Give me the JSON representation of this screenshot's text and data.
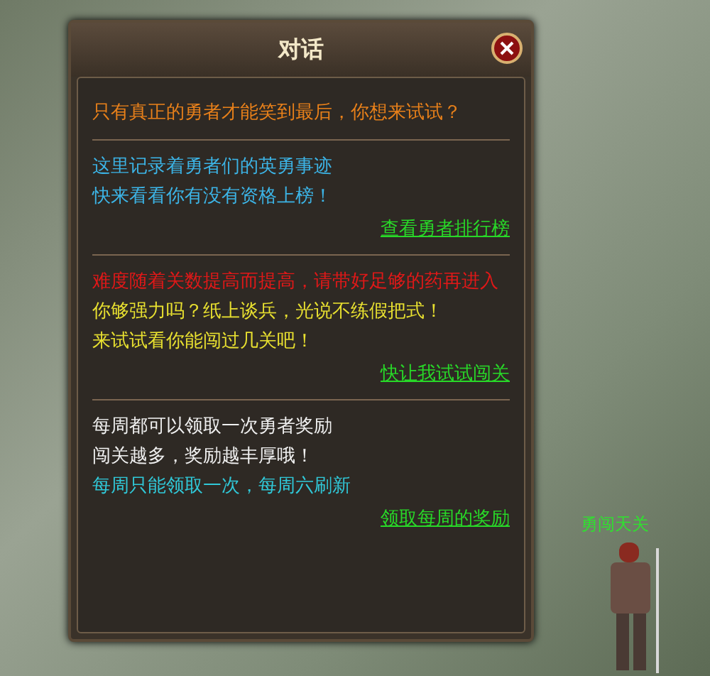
{
  "dialog": {
    "title": "对话",
    "sections": [
      {
        "lines": [
          {
            "text": "只有真正的勇者才能笑到最后，你想来试试？",
            "color": "#e8801a"
          }
        ]
      },
      {
        "lines": [
          {
            "text": "这里记录着勇者们的英勇事迹",
            "color": "#3cb4e6"
          },
          {
            "text": "快来看看你有没有资格上榜！",
            "color": "#3cb4e6"
          }
        ],
        "link": "查看勇者排行榜"
      },
      {
        "lines": [
          {
            "text": "难度随着关数提高而提高，请带好足够的药再进入",
            "color": "#e01818"
          },
          {
            "text": "你够强力吗？纸上谈兵，光说不练假把式！",
            "color": "#e8e030"
          },
          {
            "text": "来试试看你能闯过几关吧！",
            "color": "#e8e030"
          }
        ],
        "link": "快让我试试闯关"
      },
      {
        "lines": [
          {
            "text": "每周都可以领取一次勇者奖励",
            "color": "#f0f0f0"
          },
          {
            "text": "闯关越多，奖励越丰厚哦！",
            "color": "#f0f0f0"
          },
          {
            "text": "每周只能领取一次，每周六刷新",
            "color": "#30c8d8"
          }
        ],
        "link": "领取每周的奖励"
      }
    ]
  },
  "npc": {
    "name": "勇闯天关"
  }
}
